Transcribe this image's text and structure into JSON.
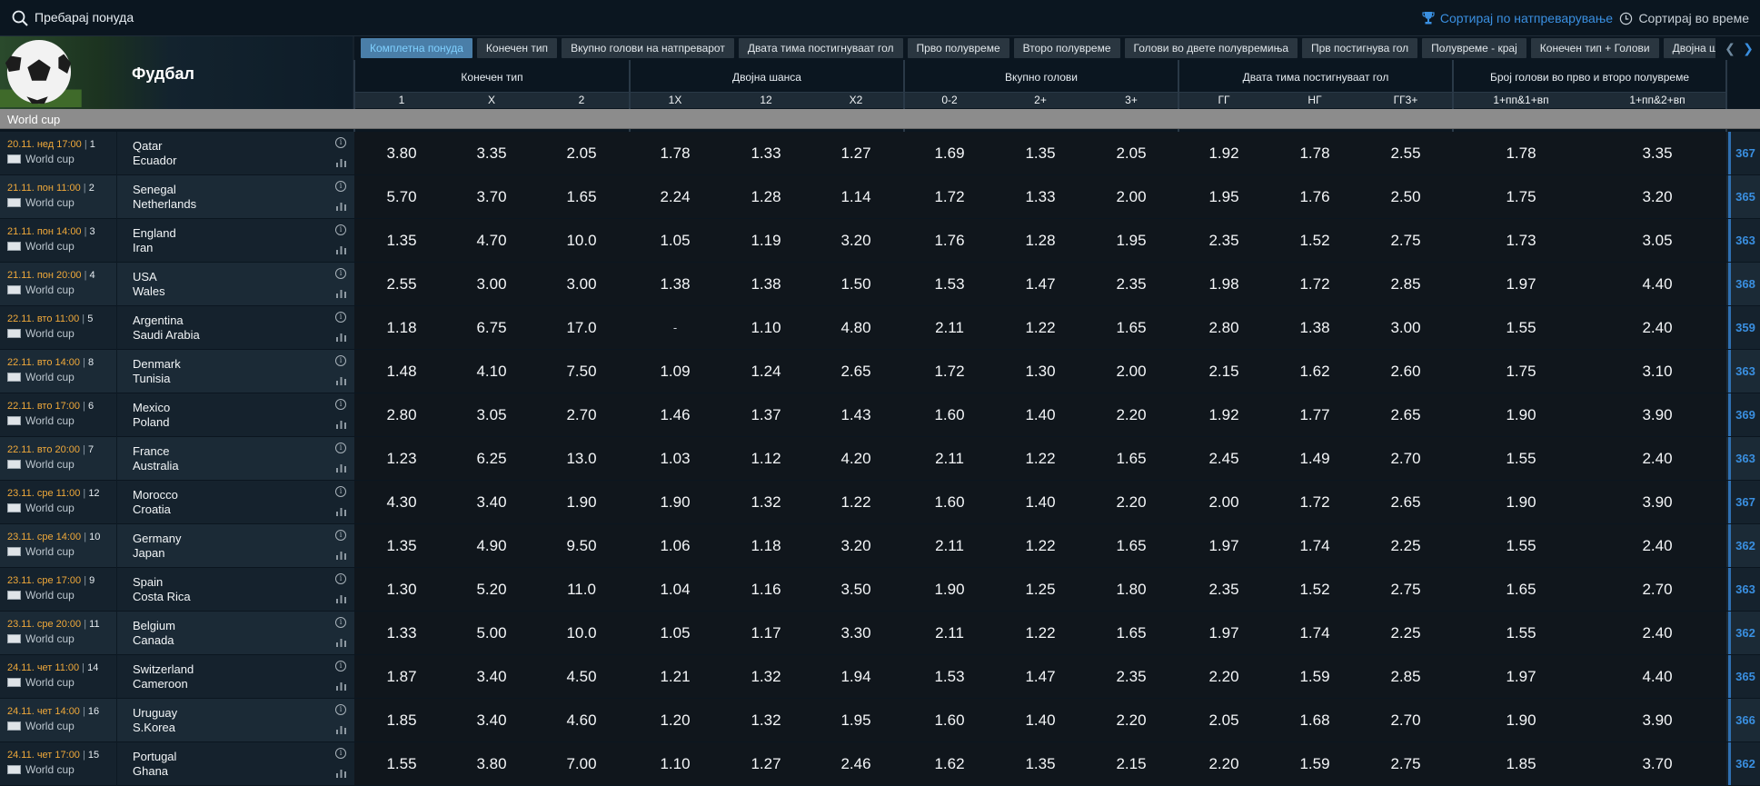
{
  "search": {
    "placeholder": "Пребарај понуда"
  },
  "sort": {
    "by_competition": "Сортирај по натпреварување",
    "by_time": "Сортирај во време"
  },
  "sport": {
    "title": "Фудбал"
  },
  "tabs": [
    {
      "label": "Комплетна понуда",
      "active": true
    },
    {
      "label": "Конечен тип"
    },
    {
      "label": "Вкупно голови на натпреварот"
    },
    {
      "label": "Двата тима постигнуваат гол"
    },
    {
      "label": "Прво полувреме"
    },
    {
      "label": "Второ полувреме"
    },
    {
      "label": "Голови во двете полувремиња"
    },
    {
      "label": "Прв постигнува гол"
    },
    {
      "label": "Полувреме - крај"
    },
    {
      "label": "Конечен тип + Голови"
    },
    {
      "label": "Двојна шанса + Голо"
    }
  ],
  "groups": [
    {
      "label": "Конечен тип",
      "cols": [
        "1",
        "X",
        "2"
      ]
    },
    {
      "label": "Двојна шанса",
      "cols": [
        "1X",
        "12",
        "X2"
      ]
    },
    {
      "label": "Вкупно голови",
      "cols": [
        "0-2",
        "2+",
        "3+"
      ]
    },
    {
      "label": "Двата тима постигнуваат гол",
      "cols": [
        "ГГ",
        "НГ",
        "ГГ3+"
      ]
    },
    {
      "label": "Број голови во прво и второ полувреме",
      "cols": [
        "1+пп&1+вп",
        "1+пп&2+вп"
      ]
    }
  ],
  "league": "World cup",
  "matches": [
    {
      "date": "20.11. нед 17:00",
      "num": "1",
      "league": "World cup",
      "home": "Qatar",
      "away": "Ecuador",
      "odds": [
        "3.80",
        "3.35",
        "2.05",
        "1.78",
        "1.33",
        "1.27",
        "1.69",
        "1.35",
        "2.05",
        "1.92",
        "1.78",
        "2.55",
        "1.78",
        "3.35"
      ],
      "more": "367"
    },
    {
      "date": "21.11. пон 11:00",
      "num": "2",
      "league": "World cup",
      "home": "Senegal",
      "away": "Netherlands",
      "odds": [
        "5.70",
        "3.70",
        "1.65",
        "2.24",
        "1.28",
        "1.14",
        "1.72",
        "1.33",
        "2.00",
        "1.95",
        "1.76",
        "2.50",
        "1.75",
        "3.20"
      ],
      "more": "365"
    },
    {
      "date": "21.11. пон 14:00",
      "num": "3",
      "league": "World cup",
      "home": "England",
      "away": "Iran",
      "odds": [
        "1.35",
        "4.70",
        "10.0",
        "1.05",
        "1.19",
        "3.20",
        "1.76",
        "1.28",
        "1.95",
        "2.35",
        "1.52",
        "2.75",
        "1.73",
        "3.05"
      ],
      "more": "363"
    },
    {
      "date": "21.11. пон 20:00",
      "num": "4",
      "league": "World cup",
      "home": "USA",
      "away": "Wales",
      "odds": [
        "2.55",
        "3.00",
        "3.00",
        "1.38",
        "1.38",
        "1.50",
        "1.53",
        "1.47",
        "2.35",
        "1.98",
        "1.72",
        "2.85",
        "1.97",
        "4.40"
      ],
      "more": "368"
    },
    {
      "date": "22.11. вто 11:00",
      "num": "5",
      "league": "World cup",
      "home": "Argentina",
      "away": "Saudi Arabia",
      "odds": [
        "1.18",
        "6.75",
        "17.0",
        "-",
        "1.10",
        "4.80",
        "2.11",
        "1.22",
        "1.65",
        "2.80",
        "1.38",
        "3.00",
        "1.55",
        "2.40"
      ],
      "more": "359"
    },
    {
      "date": "22.11. вто 14:00",
      "num": "8",
      "league": "World cup",
      "home": "Denmark",
      "away": "Tunisia",
      "odds": [
        "1.48",
        "4.10",
        "7.50",
        "1.09",
        "1.24",
        "2.65",
        "1.72",
        "1.30",
        "2.00",
        "2.15",
        "1.62",
        "2.60",
        "1.75",
        "3.10"
      ],
      "more": "363"
    },
    {
      "date": "22.11. вто 17:00",
      "num": "6",
      "league": "World cup",
      "home": "Mexico",
      "away": "Poland",
      "odds": [
        "2.80",
        "3.05",
        "2.70",
        "1.46",
        "1.37",
        "1.43",
        "1.60",
        "1.40",
        "2.20",
        "1.92",
        "1.77",
        "2.65",
        "1.90",
        "3.90"
      ],
      "more": "369"
    },
    {
      "date": "22.11. вто 20:00",
      "num": "7",
      "league": "World cup",
      "home": "France",
      "away": "Australia",
      "odds": [
        "1.23",
        "6.25",
        "13.0",
        "1.03",
        "1.12",
        "4.20",
        "2.11",
        "1.22",
        "1.65",
        "2.45",
        "1.49",
        "2.70",
        "1.55",
        "2.40"
      ],
      "more": "363"
    },
    {
      "date": "23.11. сре 11:00",
      "num": "12",
      "league": "World cup",
      "home": "Morocco",
      "away": "Croatia",
      "odds": [
        "4.30",
        "3.40",
        "1.90",
        "1.90",
        "1.32",
        "1.22",
        "1.60",
        "1.40",
        "2.20",
        "2.00",
        "1.72",
        "2.65",
        "1.90",
        "3.90"
      ],
      "more": "367"
    },
    {
      "date": "23.11. сре 14:00",
      "num": "10",
      "league": "World cup",
      "home": "Germany",
      "away": "Japan",
      "odds": [
        "1.35",
        "4.90",
        "9.50",
        "1.06",
        "1.18",
        "3.20",
        "2.11",
        "1.22",
        "1.65",
        "1.97",
        "1.74",
        "2.25",
        "1.55",
        "2.40"
      ],
      "more": "362"
    },
    {
      "date": "23.11. сре 17:00",
      "num": "9",
      "league": "World cup",
      "home": "Spain",
      "away": "Costa Rica",
      "odds": [
        "1.30",
        "5.20",
        "11.0",
        "1.04",
        "1.16",
        "3.50",
        "1.90",
        "1.25",
        "1.80",
        "2.35",
        "1.52",
        "2.75",
        "1.65",
        "2.70"
      ],
      "more": "363"
    },
    {
      "date": "23.11. сре 20:00",
      "num": "11",
      "league": "World cup",
      "home": "Belgium",
      "away": "Canada",
      "odds": [
        "1.33",
        "5.00",
        "10.0",
        "1.05",
        "1.17",
        "3.30",
        "2.11",
        "1.22",
        "1.65",
        "1.97",
        "1.74",
        "2.25",
        "1.55",
        "2.40"
      ],
      "more": "362"
    },
    {
      "date": "24.11. чет 11:00",
      "num": "14",
      "league": "World cup",
      "home": "Switzerland",
      "away": "Cameroon",
      "odds": [
        "1.87",
        "3.40",
        "4.50",
        "1.21",
        "1.32",
        "1.94",
        "1.53",
        "1.47",
        "2.35",
        "2.20",
        "1.59",
        "2.85",
        "1.97",
        "4.40"
      ],
      "more": "365"
    },
    {
      "date": "24.11. чет 14:00",
      "num": "16",
      "league": "World cup",
      "home": "Uruguay",
      "away": "S.Korea",
      "odds": [
        "1.85",
        "3.40",
        "4.60",
        "1.20",
        "1.32",
        "1.95",
        "1.60",
        "1.40",
        "2.20",
        "2.05",
        "1.68",
        "2.70",
        "1.90",
        "3.90"
      ],
      "more": "366"
    },
    {
      "date": "24.11. чет 17:00",
      "num": "15",
      "league": "World cup",
      "home": "Portugal",
      "away": "Ghana",
      "odds": [
        "1.55",
        "3.80",
        "7.00",
        "1.10",
        "1.27",
        "2.46",
        "1.62",
        "1.35",
        "2.15",
        "2.20",
        "1.59",
        "2.75",
        "1.85",
        "3.70"
      ],
      "more": "362"
    }
  ]
}
